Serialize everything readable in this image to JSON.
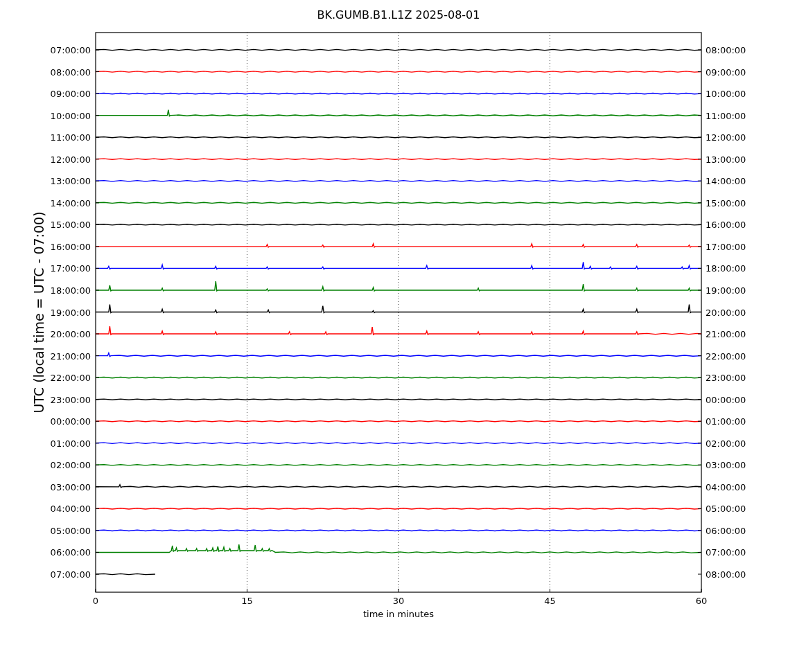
{
  "title": "BK.GUMB.B1.L1Z 2025-08-01",
  "ylabel": "UTC (local time = UTC - 07:00)",
  "xlabel": "time in minutes",
  "xticks": [
    "0",
    "15",
    "30",
    "45",
    "60"
  ],
  "rows": [
    {
      "left": "07:00:00",
      "right": "08:00:00",
      "color": "#000000",
      "kind": "full"
    },
    {
      "left": "08:00:00",
      "right": "09:00:00",
      "color": "#ff0000",
      "kind": "full"
    },
    {
      "left": "09:00:00",
      "right": "10:00:00",
      "color": "#0000ff",
      "kind": "full"
    },
    {
      "left": "10:00:00",
      "right": "11:00:00",
      "color": "#008000",
      "kind": "full"
    },
    {
      "left": "11:00:00",
      "right": "12:00:00",
      "color": "#000000",
      "kind": "full"
    },
    {
      "left": "12:00:00",
      "right": "13:00:00",
      "color": "#ff0000",
      "kind": "full"
    },
    {
      "left": "13:00:00",
      "right": "14:00:00",
      "color": "#0000ff",
      "kind": "full"
    },
    {
      "left": "14:00:00",
      "right": "15:00:00",
      "color": "#008000",
      "kind": "full"
    },
    {
      "left": "15:00:00",
      "right": "16:00:00",
      "color": "#000000",
      "kind": "full"
    },
    {
      "left": "16:00:00",
      "right": "17:00:00",
      "color": "#ff0000",
      "kind": "full"
    },
    {
      "left": "17:00:00",
      "right": "18:00:00",
      "color": "#0000ff",
      "kind": "full"
    },
    {
      "left": "18:00:00",
      "right": "19:00:00",
      "color": "#008000",
      "kind": "full"
    },
    {
      "left": "19:00:00",
      "right": "20:00:00",
      "color": "#000000",
      "kind": "full"
    },
    {
      "left": "20:00:00",
      "right": "21:00:00",
      "color": "#ff0000",
      "kind": "full"
    },
    {
      "left": "21:00:00",
      "right": "22:00:00",
      "color": "#0000ff",
      "kind": "full"
    },
    {
      "left": "22:00:00",
      "right": "23:00:00",
      "color": "#008000",
      "kind": "full"
    },
    {
      "left": "23:00:00",
      "right": "00:00:00",
      "color": "#000000",
      "kind": "full"
    },
    {
      "left": "00:00:00",
      "right": "01:00:00",
      "color": "#ff0000",
      "kind": "full"
    },
    {
      "left": "01:00:00",
      "right": "02:00:00",
      "color": "#0000ff",
      "kind": "full"
    },
    {
      "left": "02:00:00",
      "right": "03:00:00",
      "color": "#008000",
      "kind": "full"
    },
    {
      "left": "03:00:00",
      "right": "04:00:00",
      "color": "#000000",
      "kind": "full"
    },
    {
      "left": "04:00:00",
      "right": "05:00:00",
      "color": "#ff0000",
      "kind": "full"
    },
    {
      "left": "05:00:00",
      "right": "06:00:00",
      "color": "#0000ff",
      "kind": "full"
    },
    {
      "left": "06:00:00",
      "right": "07:00:00",
      "color": "#008000",
      "kind": "full"
    },
    {
      "left": "07:00:00",
      "right": "08:00:00",
      "color": "#000000",
      "kind": "partial"
    }
  ]
}
